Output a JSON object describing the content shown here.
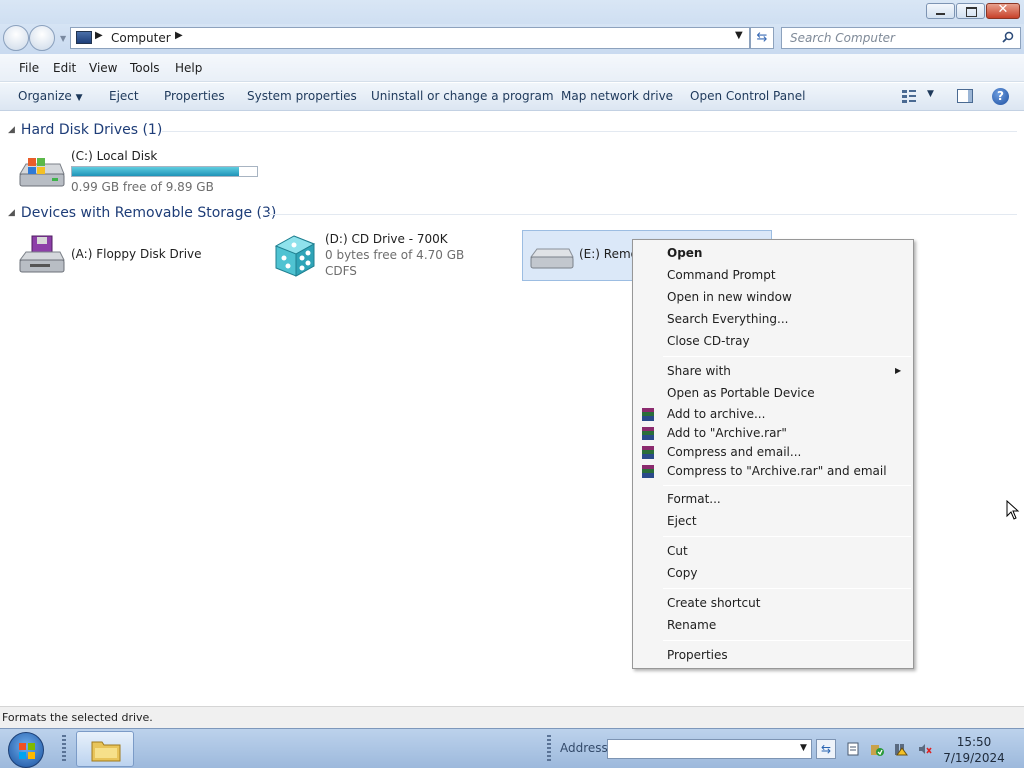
{
  "window": {
    "title_controls": {
      "minimize": "minimize",
      "maximize": "restore",
      "close": "x"
    }
  },
  "navigation": {
    "address_path": "Computer",
    "search_placeholder": "Search Computer"
  },
  "menu_bar": [
    "File",
    "Edit",
    "View",
    "Tools",
    "Help"
  ],
  "command_bar": {
    "organize": "Organize",
    "eject": "Eject",
    "properties": "Properties",
    "system_properties": "System properties",
    "uninstall": "Uninstall or change a program",
    "map_drive": "Map network drive",
    "control_panel": "Open Control Panel"
  },
  "groups": {
    "hard_disks": {
      "title": "Hard Disk Drives (1)",
      "drives": [
        {
          "name": "(C:) Local Disk",
          "free": "0.99 GB free of 9.89 GB",
          "used_fraction": 0.9
        }
      ]
    },
    "removable": {
      "title": "Devices with Removable Storage (3)",
      "drives": [
        {
          "name": "(A:) Floppy Disk Drive"
        },
        {
          "name": "(D:) CD Drive - 700K",
          "free": "0 bytes free of 4.70 GB",
          "fs": "CDFS"
        },
        {
          "name": "(E:) Remov"
        }
      ]
    }
  },
  "context_menu": {
    "items": [
      "Open",
      "Command Prompt",
      "Open in new window",
      "Search Everything...",
      "Close CD-tray",
      "Share with",
      "Open as Portable Device",
      "Add to archive...",
      "Add to \"Archive.rar\"",
      "Compress and email...",
      "Compress to \"Archive.rar\" and email",
      "Format...",
      "Eject",
      "Cut",
      "Copy",
      "Create shortcut",
      "Rename",
      "Properties"
    ]
  },
  "status_bar": {
    "text": "Formats the selected drive."
  },
  "taskbar": {
    "address_label": "Address",
    "time": "15:50",
    "date": "7/19/2024"
  }
}
